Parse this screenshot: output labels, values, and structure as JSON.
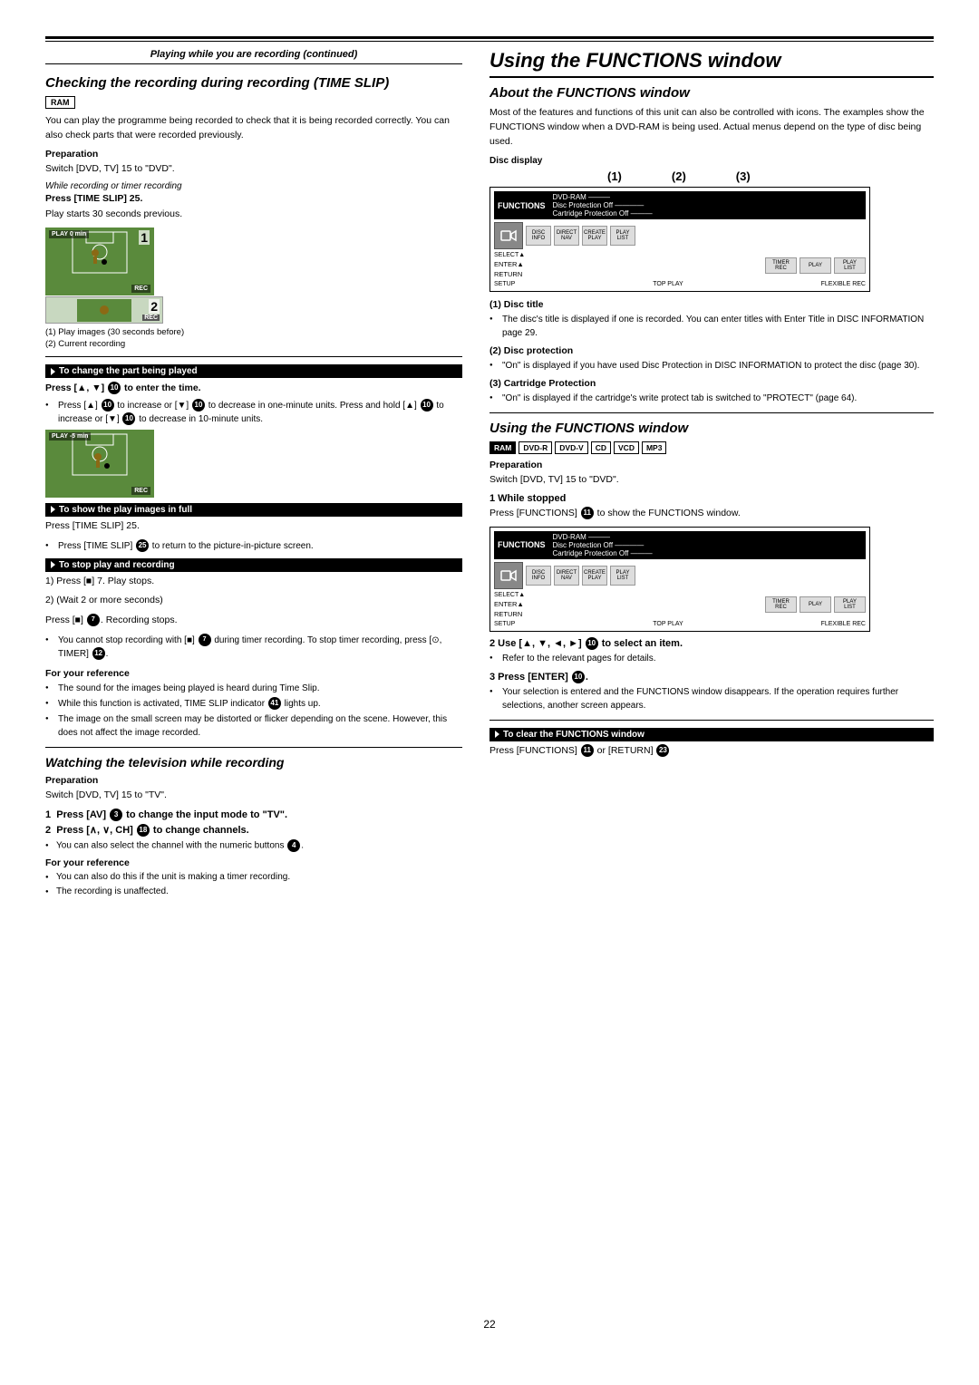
{
  "page": {
    "number": "22",
    "header_italic": "Playing while you are recording (continued)"
  },
  "left_column": {
    "section1": {
      "title": "Checking the recording during recording (TIME SLIP)",
      "ram_badge": "RAM",
      "body": "You can play the programme being recorded to check that it is being recorded correctly. You can also check parts that were recorded previously.",
      "preparation_label": "Preparation",
      "preparation_text": "Switch [DVD, TV] 15 to \"DVD\".",
      "while_recording_label": "While recording or timer recording",
      "press_instruction": "Press [TIME SLIP] 25.",
      "after_press": "Play starts 30 seconds previous.",
      "image_labels": [
        "(1)",
        "(2)"
      ],
      "captions": [
        "(1) Play images (30 seconds before)",
        "(2) Current recording"
      ]
    },
    "section1_sub": {
      "change_part_header": "To change the part being played",
      "change_part_press": "Press [▲, ▼] 10 to enter the time.",
      "change_part_bullet1": "Press [▲] 10 to increase or [▼] 10 to decrease in one-minute units. Press and hold [▲] 10 to increase or [▼] 10 to decrease in 10-minute units."
    },
    "section1_sub2": {
      "show_images_header": "To show the play images in full",
      "show_images_text": "Press [TIME SLIP] 25.",
      "show_images_bullet": "Press [TIME SLIP] 25 to return to the picture-in-picture screen."
    },
    "section1_sub3": {
      "stop_header": "To stop play and recording",
      "stop_1": "1) Press [■] 7. Play stops.",
      "stop_2": "2) (Wait 2 or more seconds)",
      "stop_2b": "Press [■] 7. Recording stops.",
      "stop_bullet": "You cannot stop recording with [■] 7 during timer recording. To stop timer recording, press [⊙, TIMER] 12."
    },
    "reference1": {
      "label": "For your reference",
      "bullets": [
        "The sound for the images being played is heard during Time Slip.",
        "While this function is activated, TIME SLIP indicator 41 lights up.",
        "The image on the small screen may be distorted or flicker depending on the scene. However, this does not affect the image recorded."
      ]
    },
    "section2": {
      "title": "Watching the television while recording",
      "preparation_label": "Preparation",
      "preparation_text": "Switch [DVD, TV] 15 to \"TV\".",
      "step1": "1  Press [AV] 3 to change the input mode to \"TV\".",
      "step2": "2  Press [∧, ∨, CH] 18 to change channels.",
      "step2_bullet": "You can also select the channel with the numeric buttons 4.",
      "reference_label": "For your reference",
      "reference_bullets": [
        "You can also do this if the unit is making a timer recording.",
        "The recording is unaffected."
      ]
    }
  },
  "right_column": {
    "main_title": "Using the FUNCTIONS window",
    "section_about": {
      "title": "About the FUNCTIONS window",
      "body": "Most of the features and functions of this unit can also be controlled with icons. The examples show the FUNCTIONS window when a DVD-RAM is being used. Actual menus depend on the type of disc being used.",
      "disc_display_label": "Disc display",
      "numbers": [
        "(1)",
        "(2)",
        "(3)"
      ],
      "display": {
        "functions_label": "FUNCTIONS",
        "dvd_ram_label": "DVD-RAM",
        "disc_protection": "Disc Protection  Off",
        "cartridge_protection": "Cartridge Protection  Off",
        "icons": [
          "DISC INFORMATION",
          "DIRECT NAVIGATOR",
          "CREATE PLAY LIST"
        ],
        "bottom_icons": [
          "TIMER RECORDING",
          "PLAY",
          "PLAY LIST"
        ],
        "bottom_labels": [
          "SELECT",
          "RETURN",
          "SETUP",
          "TOP PLAY",
          "FLEXIBLE REC"
        ],
        "enter_label": "ENTER▲"
      },
      "disc_title_label": "(1) Disc title",
      "disc_title_text": "The disc's title is displayed if one is recorded. You can enter titles with Enter Title in DISC INFORMATION page 29.",
      "disc_protection_label": "(2) Disc protection",
      "disc_protection_text": "\"On\" is displayed if you have used Disc Protection in DISC INFORMATION to protect the disc (page 30).",
      "cartridge_label": "(3) Cartridge Protection",
      "cartridge_text": "\"On\" is displayed if the cartridge's write protect tab is switched to \"PROTECT\" (page 64)."
    },
    "section_using": {
      "title": "Using the FUNCTIONS window",
      "format_badges": [
        "RAM",
        "DVD-R",
        "DVD-V",
        "CD",
        "VCD",
        "MP3"
      ],
      "preparation_label": "Preparation",
      "preparation_text": "Switch [DVD, TV] 15 to \"DVD\".",
      "step1_label": "1  While stopped",
      "step1_press": "Press [FUNCTIONS] 11 to show the FUNCTIONS window.",
      "display2": {
        "functions_label": "FUNCTIONS",
        "dvd_ram_label": "DVD-RAM",
        "disc_protection": "Disc Protection  Off",
        "cartridge_protection": "Cartridge Protection  Off"
      },
      "step2_label": "2  Use [▲, ▼, ◄, ►] 10 to select an item.",
      "step2_bullet": "Refer to the relevant pages for details.",
      "step3_label": "3  Press [ENTER] 10.",
      "step3_bullet": "Your selection is entered and the FUNCTIONS window disappears. If the operation requires further selections, another screen appears.",
      "clear_header": "To clear the FUNCTIONS window",
      "clear_text": "Press [FUNCTIONS] 11 or [RETURN] 23"
    }
  }
}
